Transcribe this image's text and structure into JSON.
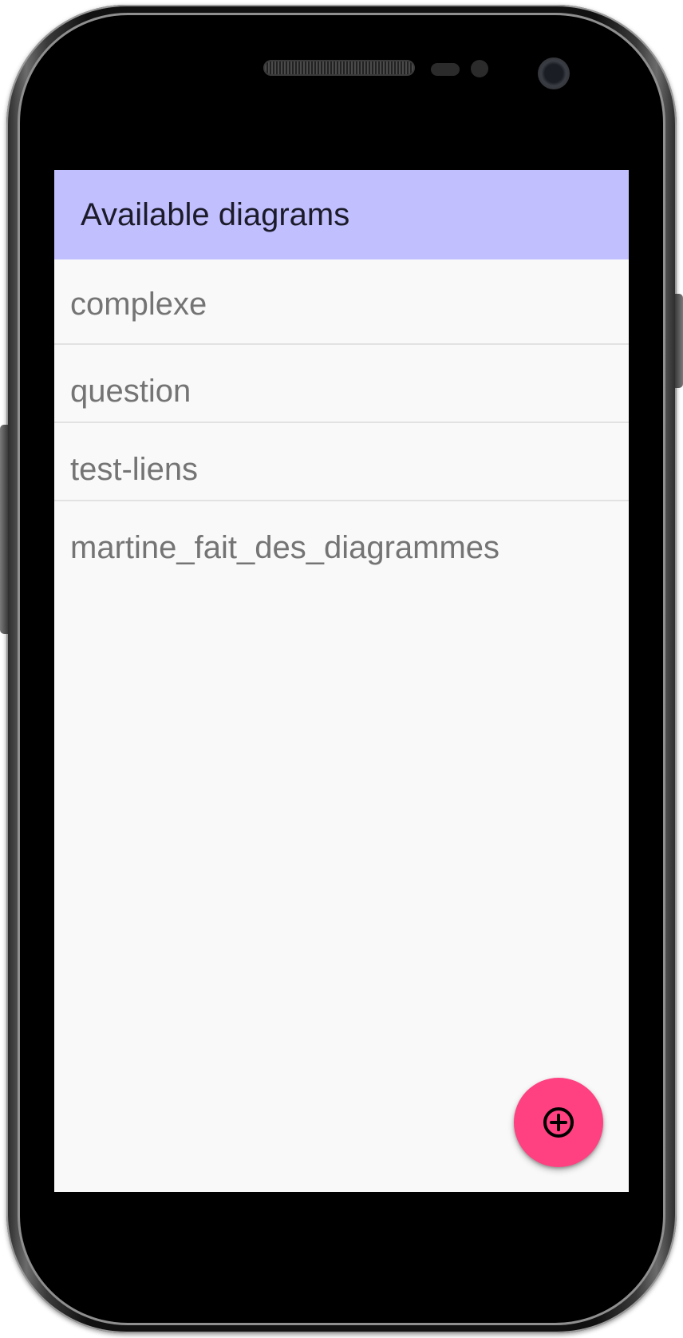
{
  "app_bar": {
    "title": "Available diagrams"
  },
  "diagrams": {
    "items": [
      {
        "label": "complexe"
      },
      {
        "label": "question"
      },
      {
        "label": "test-liens"
      },
      {
        "label": "martine_fait_des_diagrammes"
      }
    ]
  },
  "fab": {
    "icon": "add-circle-icon"
  },
  "colors": {
    "app_bar_background": "#c1bffe",
    "fab_background": "#ff4081",
    "screen_background": "#f9f9f9",
    "list_text": "#747474",
    "title_text": "#1c1b2a"
  }
}
